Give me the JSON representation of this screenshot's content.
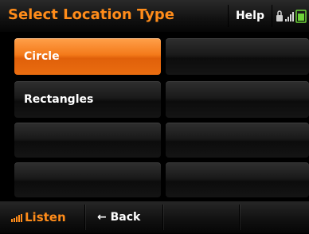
{
  "header": {
    "title": "Select Location Type",
    "help_label": "Help"
  },
  "status_icons": [
    "lock-icon",
    "signal-icon",
    "battery-icon"
  ],
  "options": [
    {
      "label": "Circle",
      "selected": true
    },
    {
      "label": "Rectangles",
      "selected": false
    }
  ],
  "footer": {
    "listen_label": "Listen",
    "back_label": "Back",
    "back_arrow": "←"
  },
  "colors": {
    "accent": "#ff8c1a",
    "selected_button": "#f47a1a",
    "background": "#000000"
  }
}
